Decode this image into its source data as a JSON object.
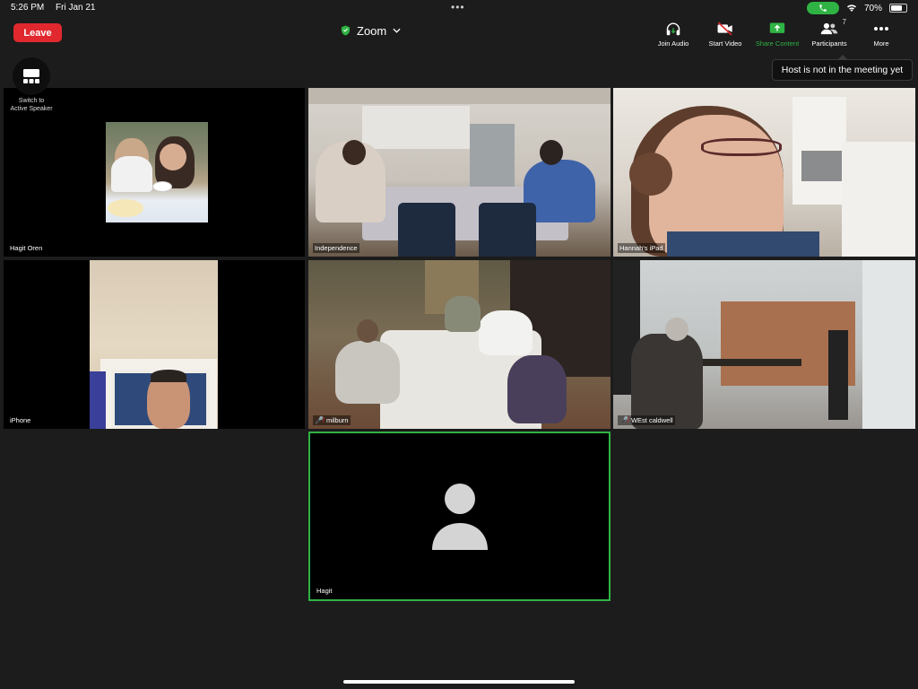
{
  "status_bar": {
    "time": "5:26 PM",
    "date": "Fri Jan 21",
    "battery": "70%"
  },
  "toolbar": {
    "leave_label": "Leave",
    "meeting_title": "Zoom",
    "join_audio_label": "Join Audio",
    "start_video_label": "Start Video",
    "share_content_label": "Share Content",
    "participants_label": "Participants",
    "participants_count": "7",
    "more_label": "More"
  },
  "tooltip": {
    "text": "Host is not in the meeting yet"
  },
  "switch_speaker": {
    "line1": "Switch to",
    "line2": "Active Speaker"
  },
  "tiles": [
    {
      "name": "Hagit Oren"
    },
    {
      "name": "Independence"
    },
    {
      "name": "Hannah's iPad"
    },
    {
      "name": "iPhone"
    },
    {
      "name": "milburn"
    },
    {
      "name": "WEst caldwell"
    },
    {
      "name": "Hagit"
    }
  ],
  "colors": {
    "leave": "#e0282e",
    "accent_green": "#2fb344",
    "background": "#1c1c1c"
  }
}
